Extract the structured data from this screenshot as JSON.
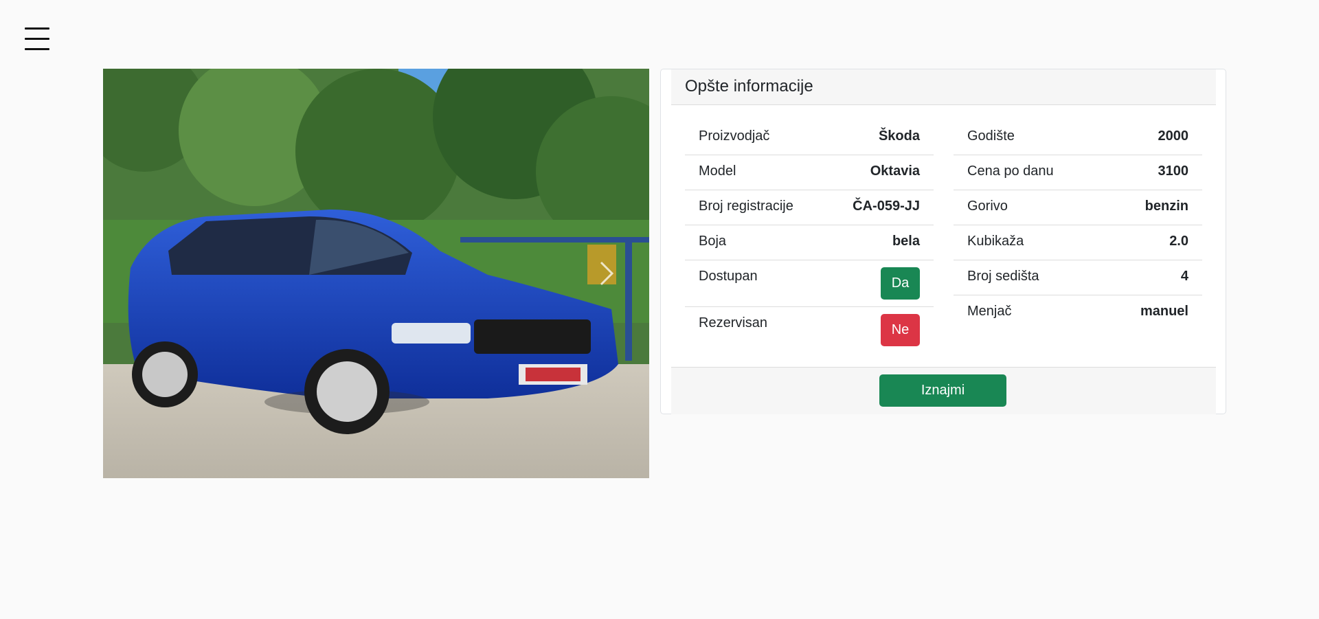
{
  "nav": {
    "menu_icon": "hamburger-menu-icon"
  },
  "carousel": {
    "next_icon": "chevron-right-icon"
  },
  "card": {
    "title": "Opšte informacije",
    "left_rows": [
      {
        "label": "Proizvodjač",
        "value": "Škoda"
      },
      {
        "label": "Model",
        "value": "Oktavia"
      },
      {
        "label": "Broj registracije",
        "value": "ČA-059-JJ"
      },
      {
        "label": "Boja",
        "value": "bela"
      },
      {
        "label": "Dostupan",
        "value": "Da",
        "status": "green"
      },
      {
        "label": "Rezervisan",
        "value": "Ne",
        "status": "red"
      }
    ],
    "right_rows": [
      {
        "label": "Godište",
        "value": "2000"
      },
      {
        "label": "Cena po danu",
        "value": "3100"
      },
      {
        "label": "Gorivo",
        "value": "benzin"
      },
      {
        "label": "Kubikaža",
        "value": "2.0"
      },
      {
        "label": "Broj sedišta",
        "value": "4"
      },
      {
        "label": "Menjač",
        "value": "manuel"
      }
    ],
    "rent_button": "Iznajmi"
  },
  "colors": {
    "success": "#198754",
    "danger": "#dc3545",
    "background": "#fafafa"
  }
}
